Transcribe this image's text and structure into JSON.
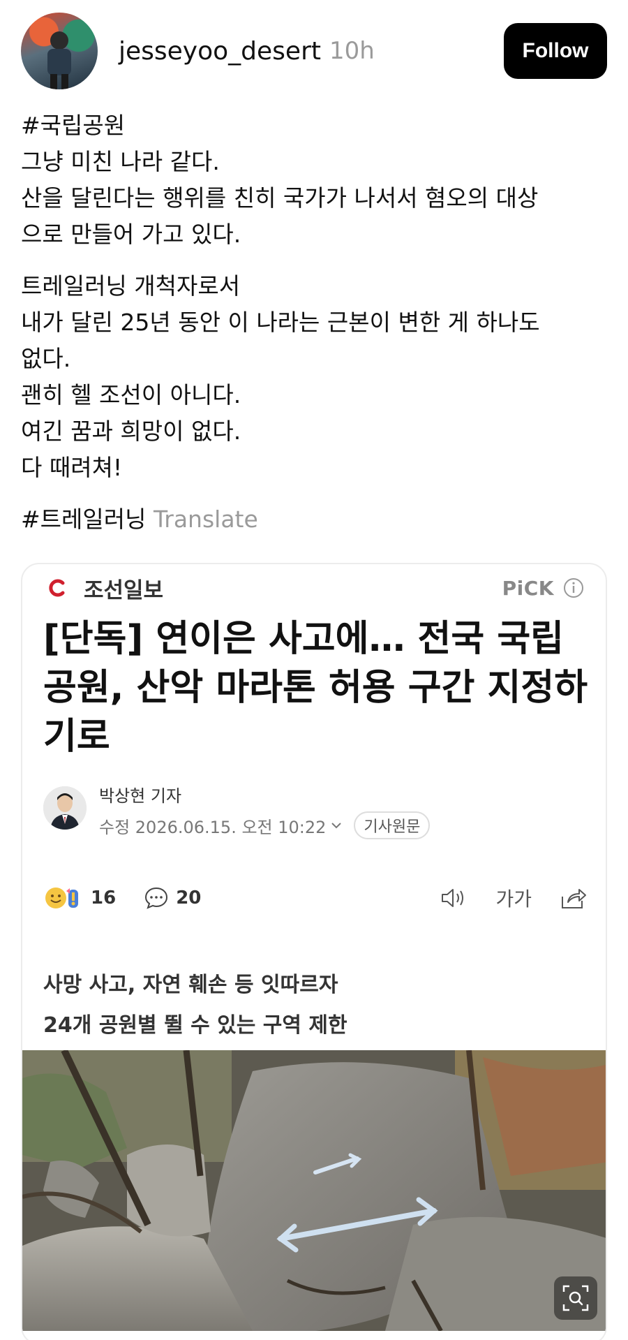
{
  "post": {
    "username": "jesseyoo_desert",
    "time": "10h",
    "follow_label": "Follow",
    "lines_group1": [
      "#국립공원",
      "그냥 미친 나라 같다.",
      "산을 달린다는 행위를 친히 국가가 나서서 혐오의 대상",
      "으로 만들어 가고 있다."
    ],
    "lines_group2": [
      "트레일러닝 개척자로서",
      "내가 달린 25년 동안 이 나라는 근본이 변한 게 하나도",
      "없다.",
      "괜히 헬 조선이 아니다.",
      "여긴 꿈과 희망이 없다.",
      "다 때려쳐!"
    ],
    "hashtag": "#트레일러닝",
    "translate_label": "Translate"
  },
  "article": {
    "press_name": "조선일보",
    "pick_label": "PiCK",
    "headline_lines": [
      "[단독] 연이은 사고에… 전국 국립",
      "공원, 산악 마라톤 허용 구간 지정하",
      "기로"
    ],
    "reporter": "박상현 기자",
    "date_label": "수정 2026.06.15. 오전 10:22",
    "origin_label": "기사원문",
    "reaction_count": "16",
    "comment_count": "20",
    "font_size_label": "가가",
    "subhead_lines": [
      "사망 사고, 자연 훼손 등 잇따르자",
      "24개 공원별 뛸 수 있는 구역 제한"
    ]
  },
  "colors": {
    "accent_red": "#d0202e",
    "muted_text": "#9a9a9a",
    "follow_bg": "#000000"
  }
}
